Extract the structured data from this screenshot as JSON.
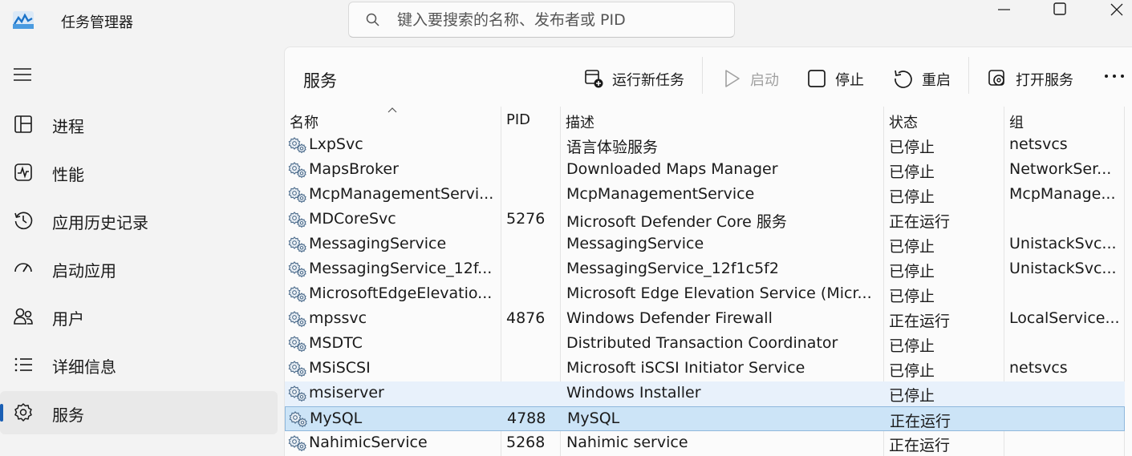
{
  "app": {
    "title": "任务管理器"
  },
  "search": {
    "placeholder": "键入要搜索的名称、发布者或 PID"
  },
  "sidebar": {
    "items": [
      {
        "label": "进程",
        "icon": "processes-grid-icon"
      },
      {
        "label": "性能",
        "icon": "performance-pulse-icon"
      },
      {
        "label": "应用历史记录",
        "icon": "history-clock-icon"
      },
      {
        "label": "启动应用",
        "icon": "startup-gauge-icon"
      },
      {
        "label": "用户",
        "icon": "users-icon"
      },
      {
        "label": "详细信息",
        "icon": "details-list-icon"
      },
      {
        "label": "服务",
        "icon": "services-gear-icon",
        "active": true
      }
    ]
  },
  "main": {
    "title": "服务",
    "toolbar": {
      "run_new_task": "运行新任务",
      "start": "启动",
      "stop": "停止",
      "restart": "重启",
      "open_services": "打开服务"
    },
    "columns": {
      "name": "名称",
      "pid": "PID",
      "description": "描述",
      "status": "状态",
      "group": "组"
    },
    "rows": [
      {
        "name": "LxpSvc",
        "pid": "",
        "description": "语言体验服务",
        "status": "已停止",
        "group": "netsvcs"
      },
      {
        "name": "MapsBroker",
        "pid": "",
        "description": "Downloaded Maps Manager",
        "status": "已停止",
        "group": "NetworkSer..."
      },
      {
        "name": "McpManagementServi...",
        "pid": "",
        "description": "McpManagementService",
        "status": "已停止",
        "group": "McpManage..."
      },
      {
        "name": "MDCoreSvc",
        "pid": "5276",
        "description": "Microsoft Defender Core 服务",
        "status": "正在运行",
        "group": ""
      },
      {
        "name": "MessagingService",
        "pid": "",
        "description": "MessagingService",
        "status": "已停止",
        "group": "UnistackSvc..."
      },
      {
        "name": "MessagingService_12f...",
        "pid": "",
        "description": "MessagingService_12f1c5f2",
        "status": "已停止",
        "group": "UnistackSvc..."
      },
      {
        "name": "MicrosoftEdgeElevatio...",
        "pid": "",
        "description": "Microsoft Edge Elevation Service (Micr...",
        "status": "已停止",
        "group": ""
      },
      {
        "name": "mpssvc",
        "pid": "4876",
        "description": "Windows Defender Firewall",
        "status": "正在运行",
        "group": "LocalService..."
      },
      {
        "name": "MSDTC",
        "pid": "",
        "description": "Distributed Transaction Coordinator",
        "status": "已停止",
        "group": ""
      },
      {
        "name": "MSiSCSI",
        "pid": "",
        "description": "Microsoft iSCSI Initiator Service",
        "status": "已停止",
        "group": "netsvcs"
      },
      {
        "name": "msiserver",
        "pid": "",
        "description": "Windows Installer",
        "status": "已停止",
        "group": "",
        "state": "hover"
      },
      {
        "name": "MySQL",
        "pid": "4788",
        "description": "MySQL",
        "status": "正在运行",
        "group": "",
        "state": "selected"
      },
      {
        "name": "NahimicService",
        "pid": "5268",
        "description": "Nahimic service",
        "status": "正在运行",
        "group": ""
      }
    ]
  },
  "colors": {
    "accent": "#1a5fb4",
    "selected_row": "#cce4f7",
    "hover_row": "#e8f1fb"
  }
}
